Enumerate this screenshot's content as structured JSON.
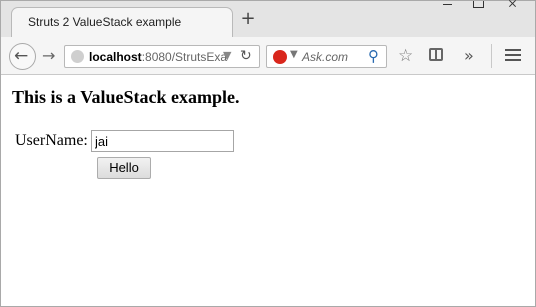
{
  "browser": {
    "tab_title": "Struts 2 ValueStack example",
    "new_tab_label": "+",
    "url_host": "localhost",
    "url_rest": ":8080/StrutsExa",
    "search_placeholder": "Ask.com",
    "icons": [
      "back-icon",
      "forward-icon",
      "globe-icon",
      "reload-icon",
      "ask-icon",
      "search-icon",
      "bookmark-star-icon",
      "reading-list-icon",
      "overflow-chevron-icon",
      "menu-icon"
    ]
  },
  "page": {
    "heading": "This is a ValueStack example.",
    "username_label": "UserName:",
    "username_value": "jai",
    "submit_label": "Hello"
  }
}
